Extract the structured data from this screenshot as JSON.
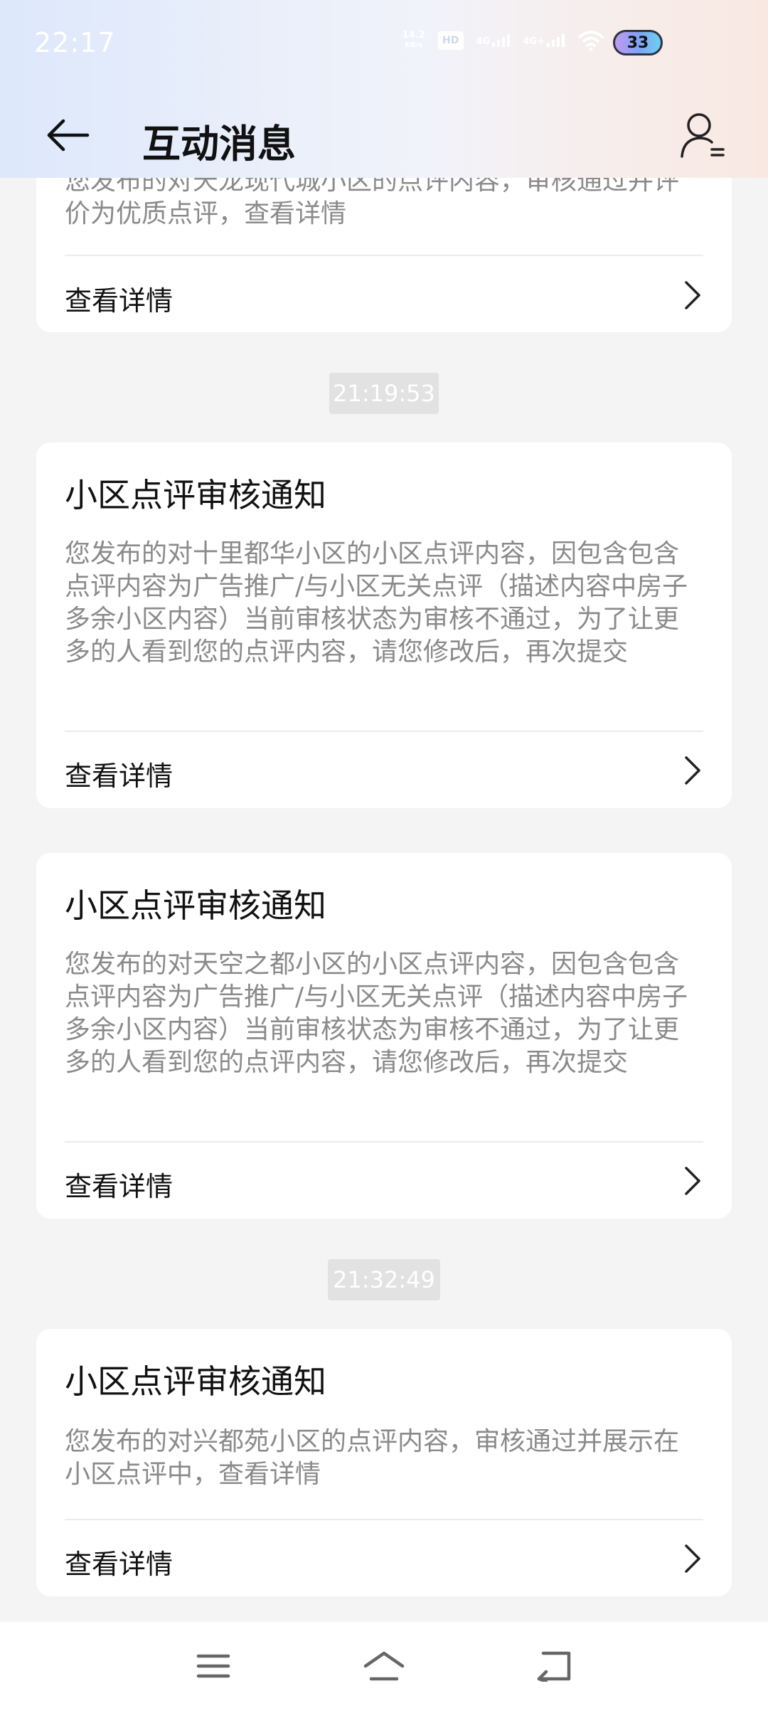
{
  "status_bar": {
    "time": "22:17",
    "net_speed_value": "14.2",
    "net_speed_unit": "KB/s",
    "hd_label": "HD",
    "sim1_label": "4G",
    "sim2_label": "4G+",
    "battery_level": "33"
  },
  "header": {
    "title": "互动消息",
    "back_icon": "arrow-left-icon",
    "profile_icon": "user-list-icon"
  },
  "cards": [
    {
      "body": "您发布的对天龙现代城小区的点评内容，审核通过并评价为优质点评，查看详情",
      "action_label": "查看详情"
    },
    {
      "timestamp": "21:19:53",
      "title": "小区点评审核通知",
      "body": "您发布的对十里都华小区的小区点评内容，因包含包含点评内容为广告推广/与小区无关点评（描述内容中房子多余小区内容）当前审核状态为审核不通过，为了让更多的人看到您的点评内容，请您修改后，再次提交",
      "action_label": "查看详情"
    },
    {
      "title": "小区点评审核通知",
      "body": "您发布的对天空之都小区的小区点评内容，因包含包含点评内容为广告推广/与小区无关点评（描述内容中房子多余小区内容）当前审核状态为审核不通过，为了让更多的人看到您的点评内容，请您修改后，再次提交",
      "action_label": "查看详情"
    },
    {
      "timestamp": "21:32:49",
      "title": "小区点评审核通知",
      "body": "您发布的对兴都苑小区的点评内容，审核通过并展示在小区点评中，查看详情",
      "action_label": "查看详情"
    }
  ],
  "nav": {
    "menu_icon": "menu-icon",
    "home_icon": "home-icon",
    "back_icon": "back-icon"
  }
}
